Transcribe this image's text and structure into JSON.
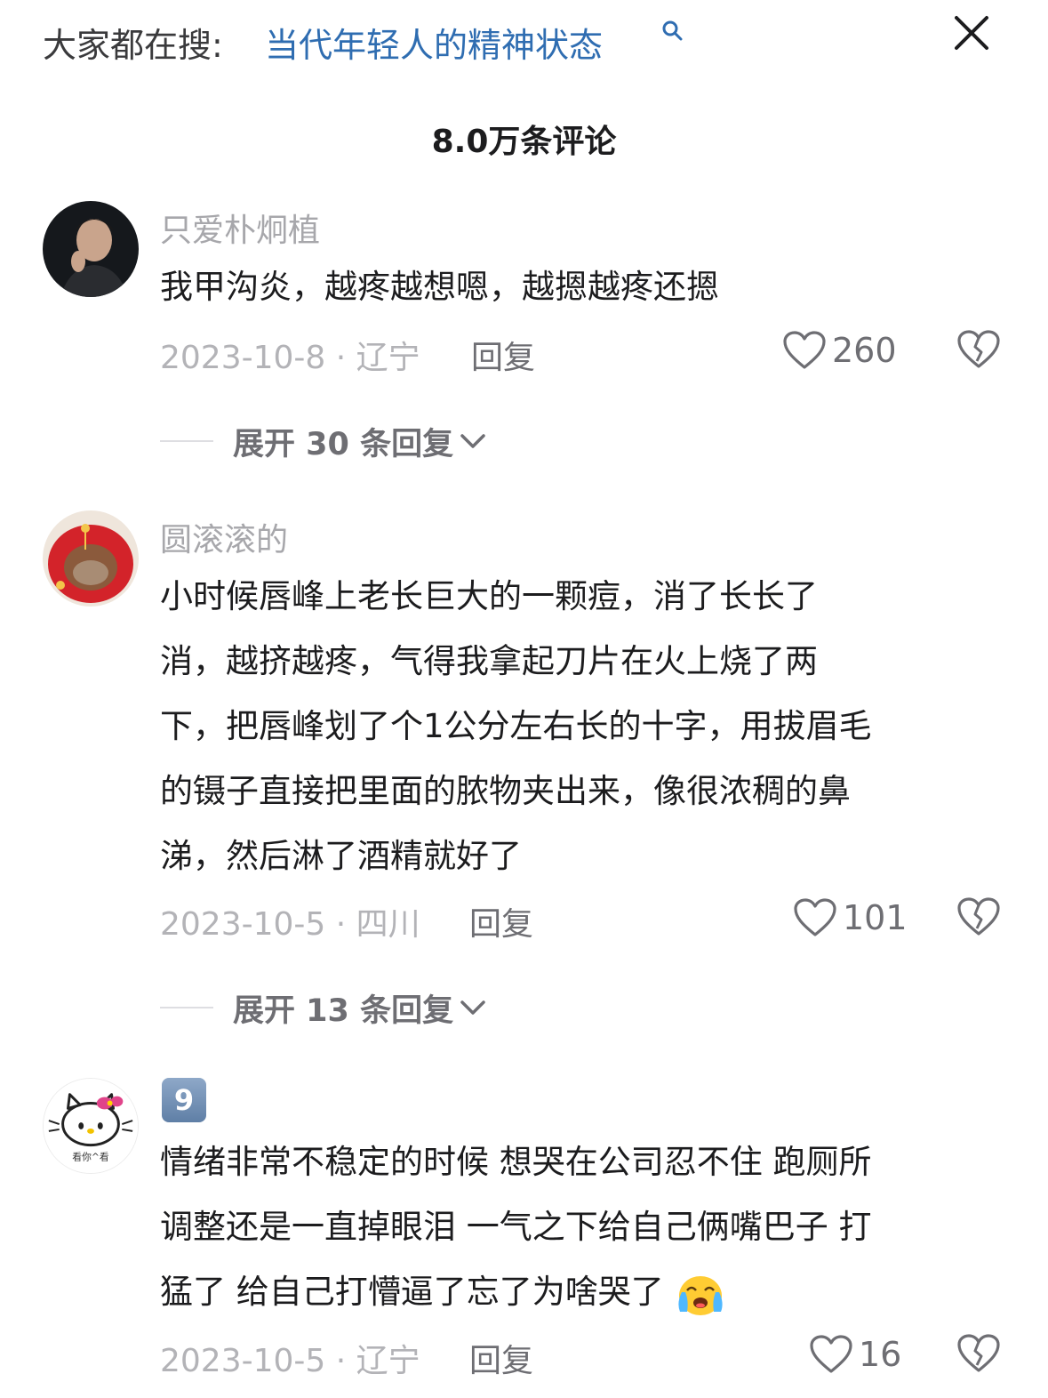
{
  "header": {
    "search_prefix": "大家都在搜:",
    "search_term": "当代年轻人的精神状态",
    "close_icon": "close-icon",
    "search_icon": "search-icon"
  },
  "comment_count": "8.0万条评论",
  "comments": [
    {
      "username": "只爱朴炯植",
      "text": "我甲沟炎，越疼越想嗯，越摁越疼还摁",
      "meta": "2023-10-8 · 辽宁",
      "reply_label": "回复",
      "likes": "260",
      "expand_label": "展开 30 条回复",
      "avatar_icon": "avatar-photo"
    },
    {
      "username": "圆滚滚的",
      "text_lines": [
        "小时候唇峰上老长巨大的一颗痘，消了长长了",
        "消，越挤越疼，气得我拿起刀片在火上烧了两",
        "下，把唇峰划了个1公分左右长的十字，用拔眉毛",
        "的镊子直接把里面的脓物夹出来，像很浓稠的鼻",
        "涕，然后淋了酒精就好了"
      ],
      "meta": "2023-10-5 · 四川",
      "reply_label": "回复",
      "likes": "101",
      "expand_label": "展开 13 条回复",
      "avatar_icon": "avatar-cat-bed"
    },
    {
      "username_badge": "9",
      "text_lines": [
        "情绪非常不稳定的时候 想哭在公司忍不住 跑厕所",
        "调整还是一直掉眼泪 一气之下给自己俩嘴巴子 打",
        "猛了 给自己打懵逼了忘了为啥哭了"
      ],
      "meta": "2023-10-5 · 辽宁",
      "reply_label": "回复",
      "likes": "16",
      "avatar_icon": "avatar-hello-kitty",
      "avatar_caption": "看你^看",
      "emoji_icon": "crying-face-icon"
    }
  ],
  "icons": {
    "like": "heart-outline-icon",
    "dislike": "broken-heart-icon",
    "expand": "chevron-down-icon"
  },
  "colors": {
    "link": "#2f6db1",
    "muted": "#b3b3b7",
    "secondary": "#6e6e73"
  }
}
